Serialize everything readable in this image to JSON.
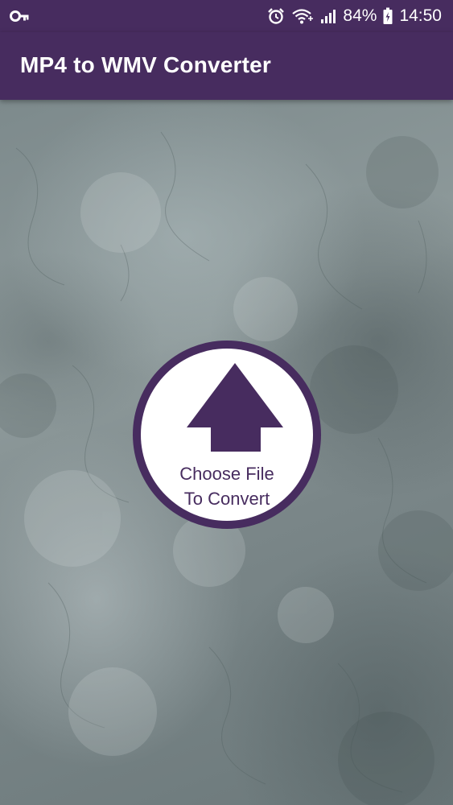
{
  "status_bar": {
    "left_icon": "key-icon",
    "icons": [
      "alarm-icon",
      "wifi-icon",
      "signal-icon"
    ],
    "battery_level": "84%",
    "battery_icon": "battery-charging-icon",
    "time": "14:50"
  },
  "app_bar": {
    "title": "MP4 to WMV Converter"
  },
  "main": {
    "upload_icon": "upload-arrow-icon",
    "upload_line1": "Choose File",
    "upload_line2": "To Convert"
  },
  "colors": {
    "primary": "#472c5f",
    "background": "#7f8b8c",
    "button_face": "#ffffff"
  }
}
